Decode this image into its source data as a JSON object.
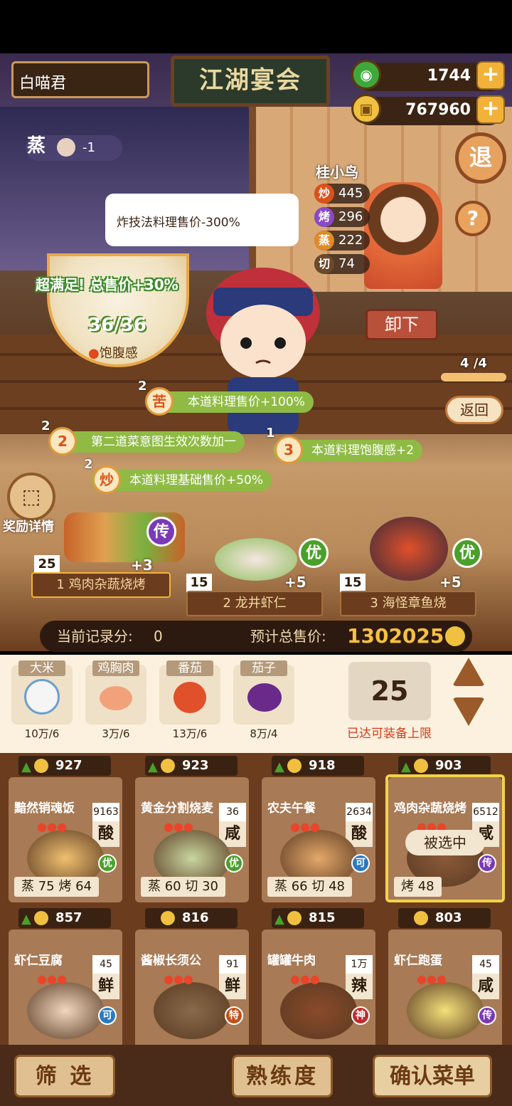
{
  "header": {
    "player_name": "白喵君",
    "banquet_title": "江湖宴会",
    "jade": "1744",
    "coins": "767960",
    "exit_label": "退",
    "help_label": "?"
  },
  "steam_status": {
    "label": "蒸",
    "value": "-1"
  },
  "tooltip": "炸技法料理售价-300%",
  "chef": {
    "name": "桂小鸟",
    "stats": [
      {
        "k": "炒",
        "v": "445",
        "color": "#d9521a"
      },
      {
        "k": "烤",
        "v": "296",
        "color": "#8a4ac8"
      },
      {
        "k": "蒸",
        "v": "222",
        "color": "#e08a2a"
      },
      {
        "k": "切",
        "v": "74",
        "color": "#6b4a2a"
      }
    ]
  },
  "satisfaction": {
    "text": "超满足!  总售价+30%",
    "fullness": "36/36",
    "fullness_label": "饱腹感"
  },
  "controls": {
    "unload": "卸下",
    "page": "4 /4",
    "back": "返回"
  },
  "buffs": [
    {
      "count": "2",
      "icon": "苦",
      "text": "本道料理售价+100%"
    },
    {
      "count": "2",
      "icon": "2",
      "text": "第二道菜意图生效次数加一"
    },
    {
      "count": "1",
      "icon": "3",
      "text": "本道料理饱腹感+2"
    },
    {
      "count": "2",
      "icon": "炒",
      "text": "本道料理基础售价+50%"
    }
  ],
  "reward_label": "奖励详情",
  "dishes": [
    {
      "index": "1",
      "name": "鸡肉杂蔬烧烤",
      "qty": "25",
      "bonus": "+3",
      "rank": "传",
      "rank_color": "#7a3ab8"
    },
    {
      "index": "2",
      "name": "龙井虾仁",
      "qty": "15",
      "bonus": "+5",
      "rank": "优",
      "rank_color": "#4aa02a"
    },
    {
      "index": "3",
      "name": "海怪章鱼烧",
      "qty": "15",
      "bonus": "+5",
      "rank": "优",
      "rank_color": "#4aa02a"
    }
  ],
  "summary": {
    "record_label": "当前记录分:",
    "record_value": "0",
    "total_label": "预计总售价:",
    "total_value": "1302025"
  },
  "ingredients": [
    {
      "name": "大米",
      "amount": "10万/6",
      "color": "#f5f5f5"
    },
    {
      "name": "鸡胸肉",
      "amount": "3万/6",
      "color": "#f2a27a"
    },
    {
      "name": "番茄",
      "amount": "13万/6",
      "color": "#e0502a"
    },
    {
      "name": "茄子",
      "amount": "8万/4",
      "color": "#6a2a8a"
    }
  ],
  "equip": {
    "count": "25",
    "limit_text": "已达可装备上限"
  },
  "recipes": [
    {
      "price": "927",
      "name": "黯然销魂饭",
      "num": "9163",
      "taste": "酸",
      "skills": "蒸 75  烤 64",
      "rank": "优",
      "rank_color": "#4aa02a",
      "img": "#f0c070",
      "up": true
    },
    {
      "price": "923",
      "name": "黄金分割烧麦",
      "num": "36",
      "taste": "咸",
      "skills": "蒸 60  切 30",
      "rank": "优",
      "rank_color": "#4aa02a",
      "img": "#c9d7a0",
      "up": true
    },
    {
      "price": "918",
      "name": "农夫午餐",
      "num": "2634",
      "taste": "酸",
      "skills": "蒸 66  切 48",
      "rank": "可",
      "rank_color": "#2a7ac0",
      "img": "#e4a86a",
      "up": true
    },
    {
      "price": "903",
      "name": "鸡肉杂蔬烧烤",
      "num": "6512",
      "taste": "咸",
      "skills": "烤 48",
      "rank": "传",
      "rank_color": "#7a3ab8",
      "img": "#8a5a3a",
      "up": true,
      "selected": "被选中"
    },
    {
      "price": "857",
      "name": "虾仁豆腐",
      "num": "45",
      "taste": "鲜",
      "skills": "",
      "rank": "可",
      "rank_color": "#2a7ac0",
      "img": "#f2d8c0",
      "up": true
    },
    {
      "price": "816",
      "name": "酱椒长须公",
      "num": "91",
      "taste": "鲜",
      "skills": "",
      "rank": "特",
      "rank_color": "#c0501a",
      "img": "#8a6a4a",
      "up": false
    },
    {
      "price": "815",
      "name": "罐罐牛肉",
      "num": "1万",
      "taste": "辣",
      "skills": "",
      "rank": "神",
      "rank_color": "#c02a2a",
      "img": "#8a4a2a",
      "up": true
    },
    {
      "price": "803",
      "name": "虾仁跑蛋",
      "num": "45",
      "taste": "咸",
      "skills": "",
      "rank": "传",
      "rank_color": "#7a3ab8",
      "img": "#f4e07a",
      "up": false
    }
  ],
  "bottom": {
    "filter": "筛 选",
    "proficiency": "熟练度",
    "confirm": "确认菜单"
  }
}
